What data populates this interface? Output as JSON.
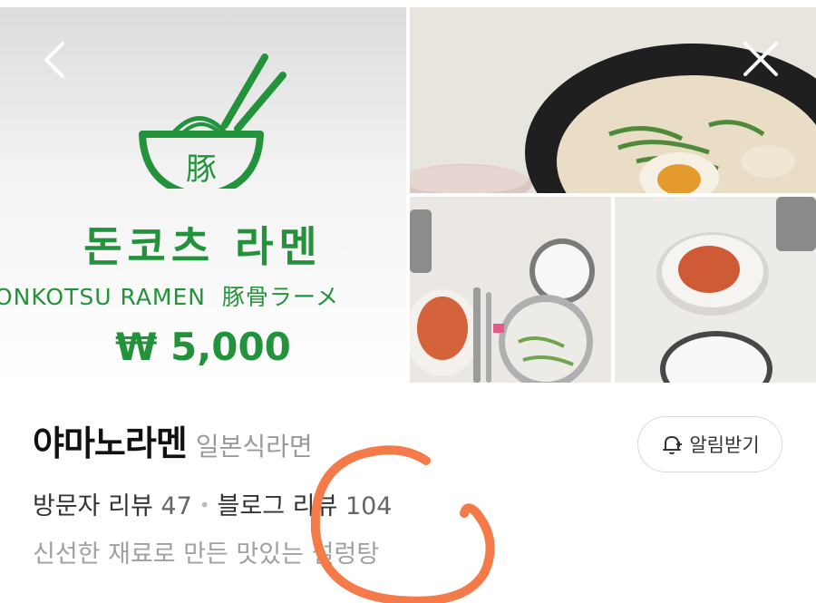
{
  "gallery": {
    "promo": {
      "name_ko": "돈코츠 라멘",
      "name_en": "ONKOTSU RAMEN",
      "name_ja": "豚骨ラーメ",
      "price": "₩ 5,000",
      "bowl_char": "豚"
    },
    "photos": [
      "ramen-bowl-photo",
      "table-setting-photo",
      "kimchi-rice-photo"
    ]
  },
  "place": {
    "name": "야마노라멘",
    "category": "일본식라면",
    "alarm_label": "알림받기",
    "visitor_review_label": "방문자 리뷰",
    "visitor_review_count": "47",
    "blog_review_label": "블로그 리뷰",
    "blog_review_count": "104",
    "tagline": "신선한 재료로 만든 맛있는 설렁탕"
  },
  "colors": {
    "brand_green": "#23933b",
    "annotation_orange": "#f47a4a"
  },
  "icons": [
    "back-icon",
    "close-icon",
    "bell-plus-icon"
  ]
}
